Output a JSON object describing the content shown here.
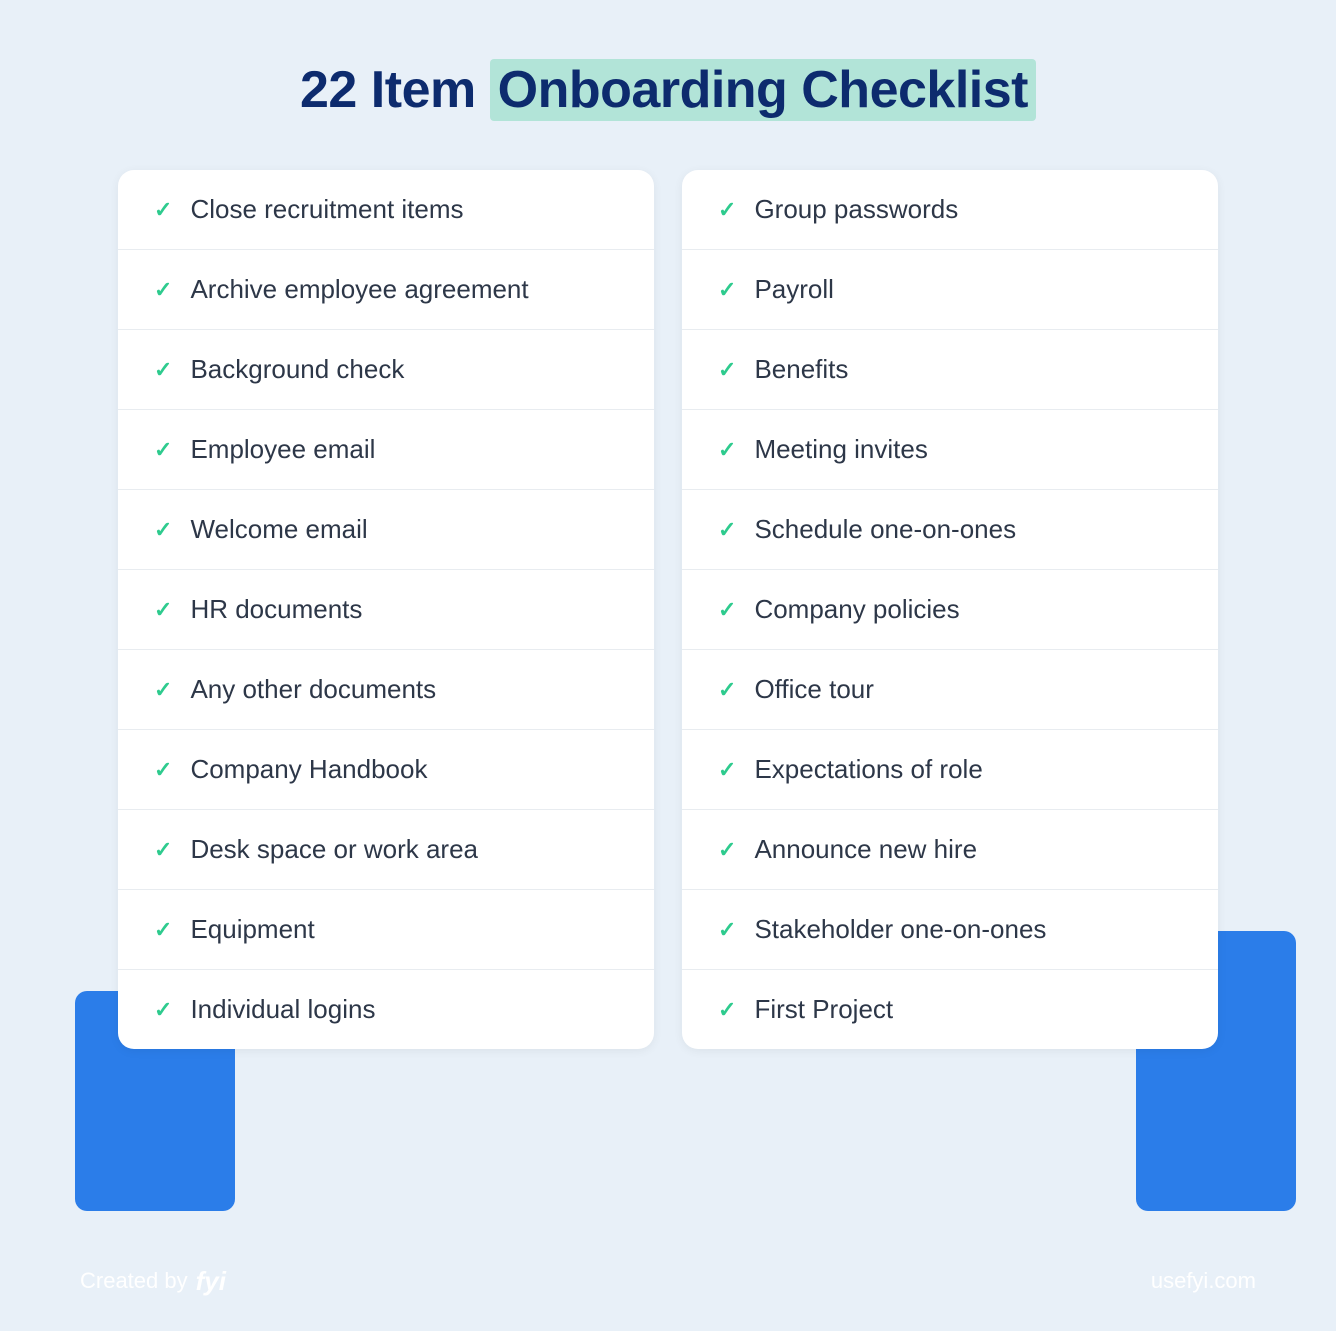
{
  "page": {
    "background_color": "#e8f0f8",
    "title": {
      "prefix": "22 Item ",
      "highlighted": "Onboarding Checklist"
    },
    "footer": {
      "created_by_label": "Created by",
      "brand": "fyi",
      "url": "usefyi.com"
    },
    "left_column": [
      "Close recruitment items",
      "Archive employee agreement",
      "Background check",
      "Employee email",
      "Welcome email",
      "HR documents",
      "Any other documents",
      "Company Handbook",
      "Desk space or work area",
      "Equipment",
      "Individual logins"
    ],
    "right_column": [
      "Group passwords",
      "Payroll",
      "Benefits",
      "Meeting invites",
      "Schedule one-on-ones",
      "Company policies",
      "Office tour",
      "Expectations of role",
      "Announce new hire",
      "Stakeholder one-on-ones",
      "First Project"
    ],
    "check_symbol": "✓",
    "colors": {
      "title_dark": "#0d2b6e",
      "highlight_bg": "#b2e4d8",
      "check_green": "#2ecb8e",
      "blue_shape": "#2b7de9",
      "item_text": "#2d3748",
      "footer_text": "#ffffff"
    }
  }
}
